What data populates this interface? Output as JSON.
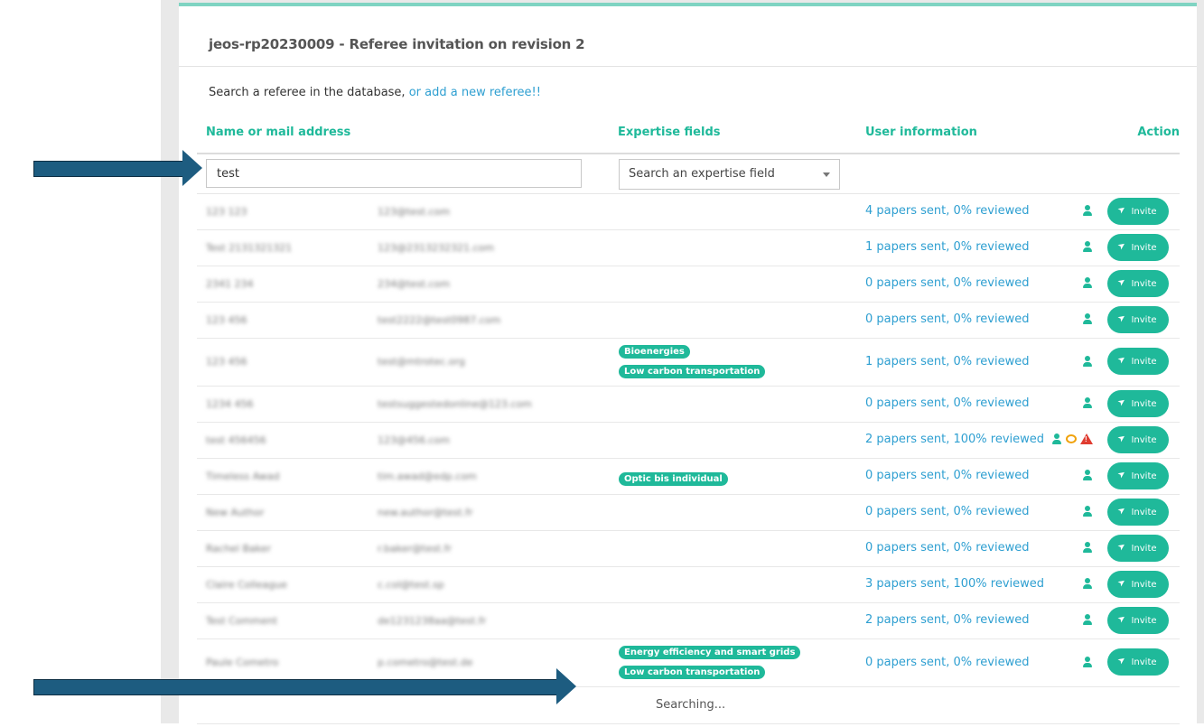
{
  "panel": {
    "title": "jeos-rp20230009 - Referee invitation on revision 2",
    "intro_text": "Search a referee in the database, ",
    "intro_link": "or add a new referee!!"
  },
  "table": {
    "headers": {
      "name": "Name or mail address",
      "expertise": "Expertise fields",
      "user_info": "User information",
      "action": "Action"
    },
    "filter": {
      "name_value": "test",
      "expertise_placeholder": "Search an expertise field"
    },
    "invite_label": "Invite",
    "rows": [
      {
        "name": "123 123",
        "email": "123@test.com",
        "tags": [],
        "info": "4 papers sent, 0% reviewed",
        "icons": [
          "user-icon"
        ]
      },
      {
        "name": "Test 2131321321",
        "email": "123@2313232321.com",
        "tags": [],
        "info": "1 papers sent, 0% reviewed",
        "icons": [
          "user-icon"
        ]
      },
      {
        "name": "2341 234",
        "email": "234@test.com",
        "tags": [],
        "info": "0 papers sent, 0% reviewed",
        "icons": [
          "user-icon"
        ]
      },
      {
        "name": "123 456",
        "email": "test2222@test0987.com",
        "tags": [],
        "info": "0 papers sent, 0% reviewed",
        "icons": [
          "user-icon"
        ]
      },
      {
        "name": "123 456",
        "email": "test@mtrotec.org",
        "tags": [
          "Bioenergies",
          "Low carbon transportation"
        ],
        "info": "1 papers sent, 0% reviewed",
        "icons": [
          "user-icon"
        ]
      },
      {
        "name": "1234 456",
        "email": "testsuggestedonline@123.com",
        "tags": [],
        "info": "0 papers sent, 0% reviewed",
        "icons": [
          "user-icon"
        ]
      },
      {
        "name": "test 456456",
        "email": "123@456.com",
        "tags": [],
        "info": "2 papers sent, 100% reviewed",
        "icons": [
          "user-icon",
          "comment-icon",
          "warning-icon"
        ]
      },
      {
        "name": "Timeless Awad",
        "email": "tim.awad@edp.com",
        "tags": [
          "Optic bis individual"
        ],
        "info": "0 papers sent, 0% reviewed",
        "icons": [
          "user-icon"
        ]
      },
      {
        "name": "New Author",
        "email": "new.author@test.fr",
        "tags": [],
        "info": "0 papers sent, 0% reviewed",
        "icons": [
          "user-icon"
        ]
      },
      {
        "name": "Rachel Baker",
        "email": "r.baker@test.fr",
        "tags": [],
        "info": "0 papers sent, 0% reviewed",
        "icons": [
          "user-icon"
        ]
      },
      {
        "name": "Claire Colleague",
        "email": "c.col@test.sp",
        "tags": [],
        "info": "3 papers sent, 100% reviewed",
        "icons": [
          "user-icon"
        ]
      },
      {
        "name": "Test Comment",
        "email": "de1231238aa@test.fr",
        "tags": [],
        "info": "2 papers sent, 0% reviewed",
        "icons": [
          "user-icon"
        ]
      },
      {
        "name": "Paule Cometro",
        "email": "p.cometro@test.de",
        "tags": [
          "Energy efficiency and smart grids",
          "Low carbon transportation"
        ],
        "info": "0 papers sent, 0% reviewed",
        "icons": [
          "user-icon"
        ]
      }
    ],
    "searching_text": "Searching..."
  },
  "colors": {
    "accent": "#1fb99a",
    "link": "#2e9fd1",
    "top_border": "#7fd4c2",
    "arrow": "#1d5c80",
    "warning": "#e03c31",
    "comment": "#f0a20b"
  }
}
